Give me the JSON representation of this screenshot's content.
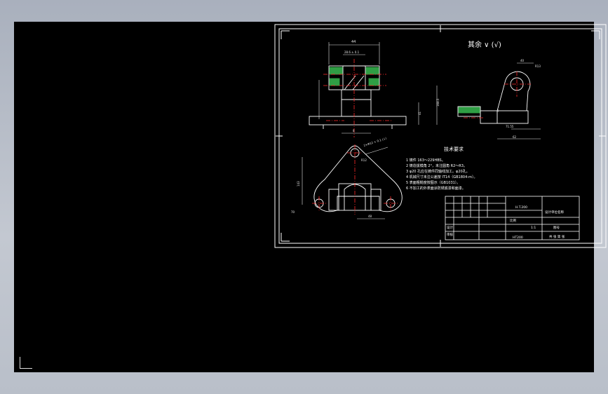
{
  "viewport": {
    "background": "#000000",
    "line_color": "#ffffff",
    "center_line_color": "#ff2a2a",
    "hatch_color": "#2f9e44",
    "dimension_color": "#e6e6e6"
  },
  "drawing": {
    "roughness_note": "其余 ∨ (√)",
    "dims": {
      "top_width": "44",
      "top_sub": "28.6 ± 0.1",
      "height_main": "168.5",
      "height_right": "41",
      "base_len": "52",
      "base_thk": "8",
      "side_top": "40",
      "side_r": "R13",
      "side_base": "62",
      "side_len": "71.55",
      "side_h": "7",
      "plan_angle": "2×Φ12 + 0.1 (↓)",
      "plan_len": "143",
      "plan_w": "48",
      "plan_r": "R12",
      "plan_h": "70"
    },
    "tech_req_title": "技术要求",
    "tech_req": [
      "1  铸件 163～229HBS。",
      "2  铸造拔模角 2°，未注圆角 R2～R3。",
      "3  φ20 孔应在铸件同轴线加工。φ20孔。",
      "4  机械尺寸未注公差按 IT14（GB1804-m）。",
      "5  表面粗糙度按图示（GB1031）。",
      "6  不加工的外表面涂防锈底漆和面漆。"
    ],
    "title_block": {
      "part_name": "H.T.200",
      "company": "设计单位名称",
      "drawing_no": "图号",
      "scale_label": "比例",
      "scale_value": "1:1",
      "designer": "设计",
      "checker": "审核",
      "material": "HT200",
      "bottom": "共 张 第 张"
    }
  }
}
